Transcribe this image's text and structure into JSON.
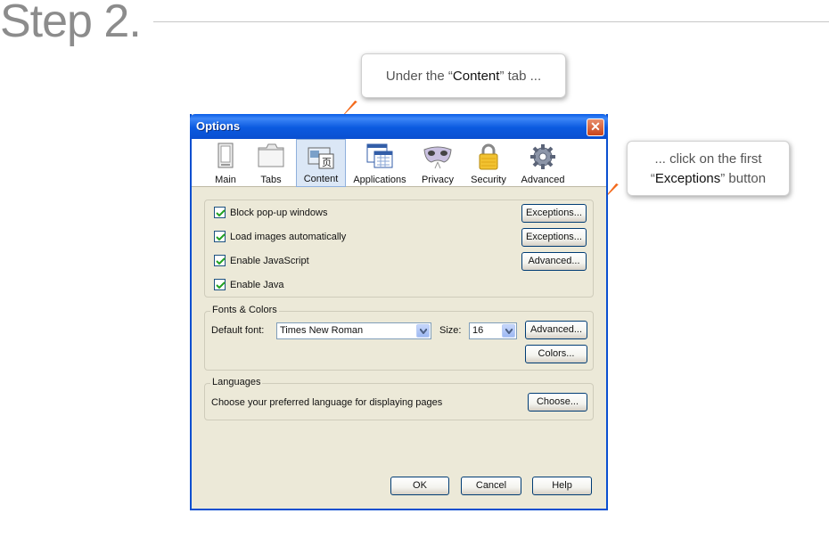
{
  "step": {
    "title": "Step 2."
  },
  "callouts": {
    "first": {
      "pre": "Under the “",
      "bold": "Content",
      "post": "” tab ..."
    },
    "second": {
      "line1": "... click on the first",
      "pre": "“",
      "bold": "Exceptions",
      "post": "” button"
    }
  },
  "dialog": {
    "title": "Options",
    "close_glyph": "✕",
    "tabs": [
      {
        "label": "Main",
        "icon": "main-icon"
      },
      {
        "label": "Tabs",
        "icon": "tabs-icon"
      },
      {
        "label": "Content",
        "icon": "content-icon",
        "selected": true
      },
      {
        "label": "Applications",
        "icon": "applications-icon"
      },
      {
        "label": "Privacy",
        "icon": "privacy-mask-icon"
      },
      {
        "label": "Security",
        "icon": "padlock-icon"
      },
      {
        "label": "Advanced",
        "icon": "gear-icon"
      }
    ],
    "content": {
      "checkboxes": [
        {
          "label": "Block pop-up windows",
          "checked": true
        },
        {
          "label": "Load images automatically",
          "checked": true
        },
        {
          "label": "Enable JavaScript",
          "checked": true
        },
        {
          "label": "Enable Java",
          "checked": true
        }
      ],
      "buttons": {
        "exceptions_popups": "Exceptions...",
        "exceptions_images": "Exceptions...",
        "advanced_js": "Advanced..."
      }
    },
    "fonts": {
      "group_title": "Fonts & Colors",
      "default_font_label": "Default font:",
      "default_font_value": "Times New Roman",
      "size_label": "Size:",
      "size_value": "16",
      "advanced_button": "Advanced...",
      "colors_button": "Colors..."
    },
    "languages": {
      "group_title": "Languages",
      "description": "Choose your preferred language for displaying pages",
      "choose_button": "Choose..."
    },
    "footer": {
      "ok": "OK",
      "cancel": "Cancel",
      "help": "Help"
    }
  },
  "colors": {
    "accent_arrow": "#f36a1c",
    "titlebar": "#0a4fd0",
    "dialog_bg": "#ece9d8"
  }
}
